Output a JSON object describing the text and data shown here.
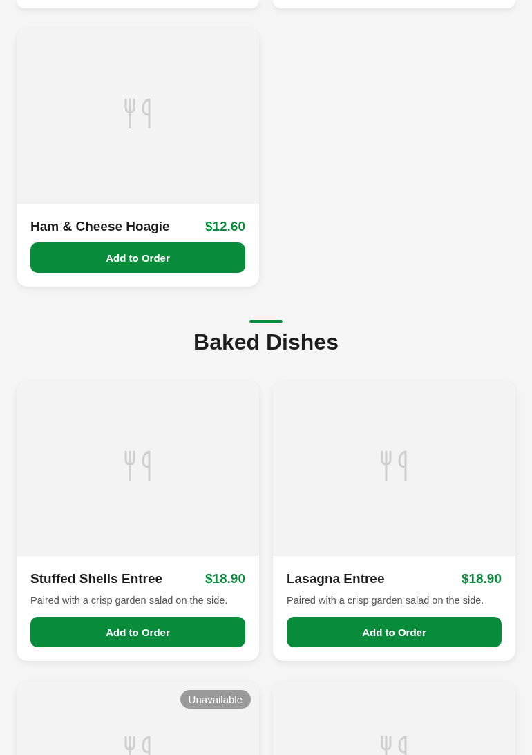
{
  "sections": [
    {
      "items": [
        {
          "kind": "cut"
        },
        {
          "kind": "cut"
        },
        {
          "kind": "card",
          "name": "Ham & Cheese Hoagie",
          "price": "$12.60",
          "button": "Add to Order"
        }
      ]
    },
    {
      "title": "Baked Dishes",
      "items": [
        {
          "kind": "card",
          "name": "Stuffed Shells Entree",
          "price": "$18.90",
          "description": "Paired with a crisp garden salad on the side.",
          "button": "Add to Order"
        },
        {
          "kind": "card",
          "name": "Lasagna Entree",
          "price": "$18.90",
          "description": "Paired with a crisp garden salad on the side.",
          "button": "Add to Order"
        },
        {
          "kind": "partial",
          "badge": "Unavailable"
        },
        {
          "kind": "partial"
        }
      ]
    }
  ]
}
